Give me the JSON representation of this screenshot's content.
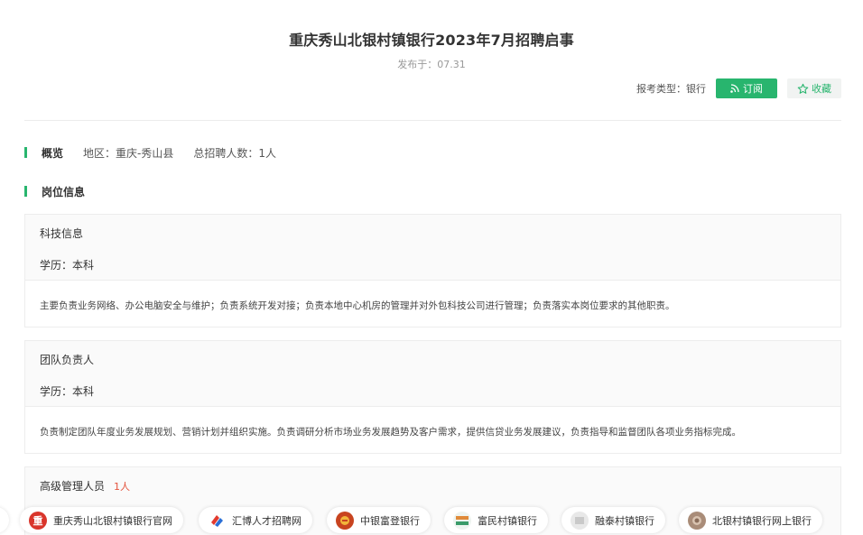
{
  "header": {
    "title": "重庆秀山北银村镇银行2023年7月招聘启事",
    "pubdate": "发布于：07.31",
    "exam_type": "报考类型：银行",
    "subscribe_label": "订阅",
    "favorite_label": "收藏"
  },
  "overview": {
    "label": "概览",
    "region": "地区：重庆-秀山县",
    "total": "总招聘人数：1人"
  },
  "positions": {
    "label": "岗位信息",
    "items": [
      {
        "name": "科技信息",
        "education": "学历：本科",
        "description": "主要负责业务网络、办公电脑安全与维护；负责系统开发对接；负责本地中心机房的管理并对外包科技公司进行管理；负责落实本岗位要求的其他职责。"
      },
      {
        "name": "团队负责人",
        "education": "学历：本科",
        "description": "负责制定团队年度业务发展规划、营销计划并组织实施。负责调研分析市场业务发展趋势及客户需求，提供信贷业务发展建议，负责指导和监督团队各项业务指标完成。"
      },
      {
        "name": "高级管理人员",
        "count": "1人"
      }
    ]
  },
  "related_links": [
    {
      "label": "重庆秀山北银村镇银行官网",
      "logo_text": "重",
      "logo_color": "#d9352b"
    },
    {
      "label": "汇博人才招聘网",
      "logo_text": "",
      "logo_color": "#e23a2e"
    },
    {
      "label": "中银富登银行",
      "logo_text": "",
      "logo_color": "#c8441f"
    },
    {
      "label": "富民村镇银行",
      "logo_text": "",
      "logo_color": "#3a9b6a"
    },
    {
      "label": "融泰村镇银行",
      "logo_text": "",
      "logo_color": "#dcdcdc"
    },
    {
      "label": "北银村镇银行网上银行",
      "logo_text": "",
      "logo_color": "#a98c78"
    }
  ],
  "colors": {
    "accent": "#28b56e",
    "count_red": "#e4533d"
  }
}
